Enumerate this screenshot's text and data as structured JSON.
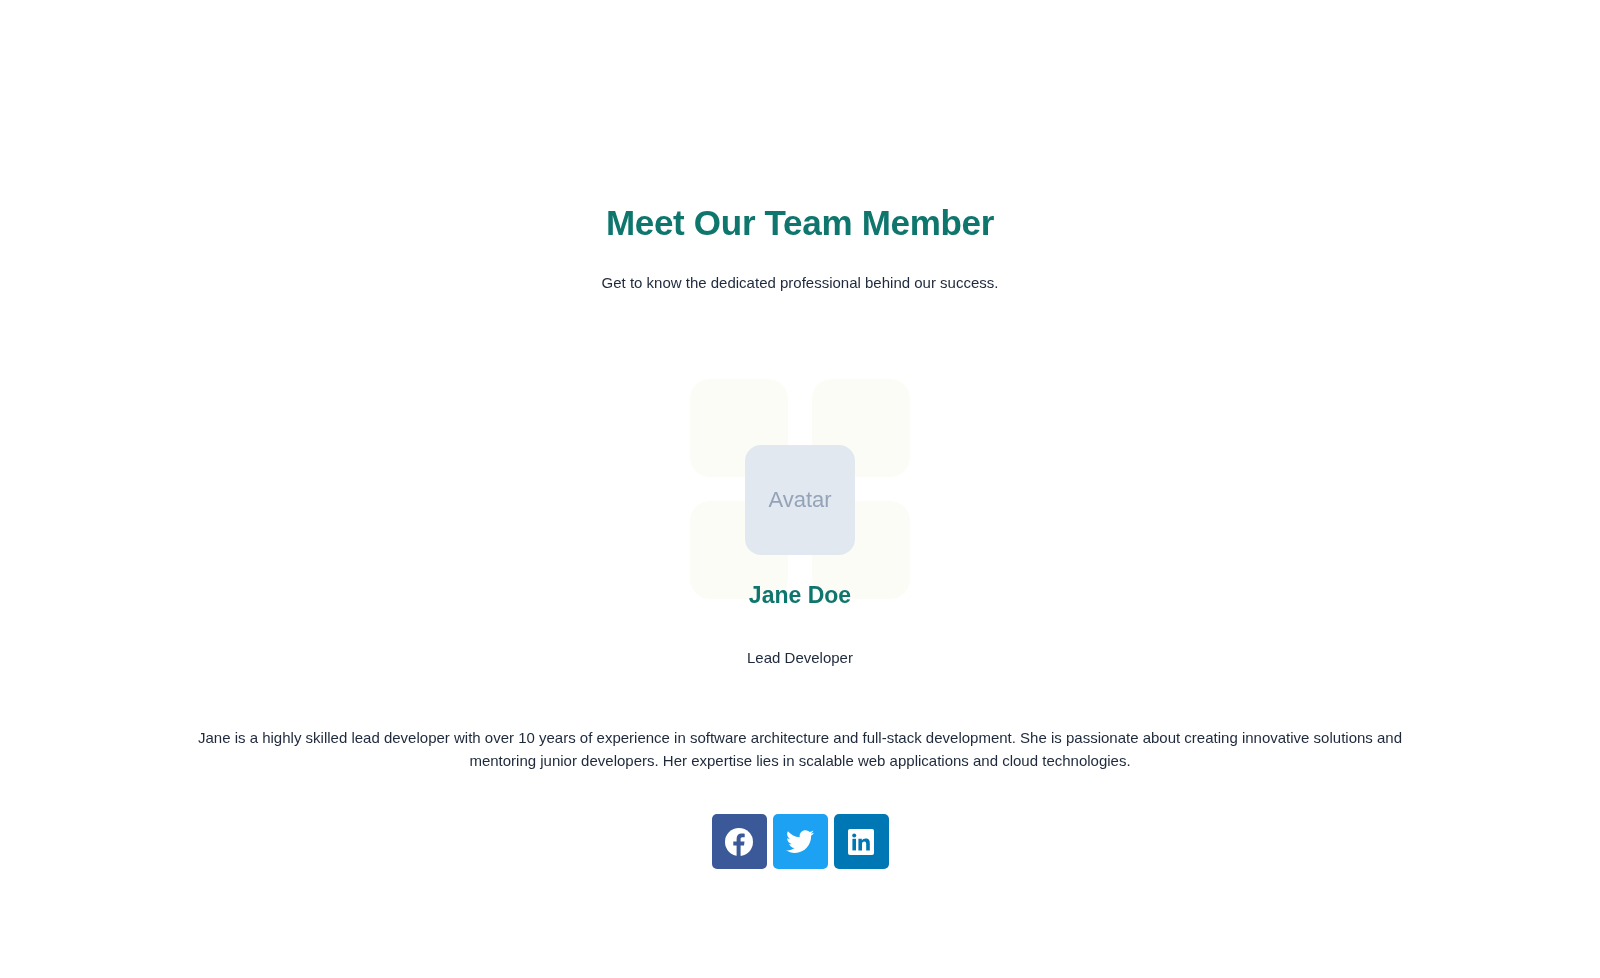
{
  "header": {
    "title": "Meet Our Team Member",
    "subtitle": "Get to know the dedicated professional behind our success."
  },
  "member": {
    "avatar_label": "Avatar",
    "name": "Jane Doe",
    "role": "Lead Developer",
    "bio": "Jane is a highly skilled lead developer with over 10 years of experience in software architecture and full-stack development. She is passionate about creating innovative solutions and mentoring junior developers. Her expertise lies in scalable web applications and cloud technologies."
  },
  "social_links": [
    {
      "kind": "facebook",
      "color": "#3b5998"
    },
    {
      "kind": "twitter",
      "color": "#1da1f2"
    },
    {
      "kind": "linkedin",
      "color": "#0077b5"
    }
  ]
}
